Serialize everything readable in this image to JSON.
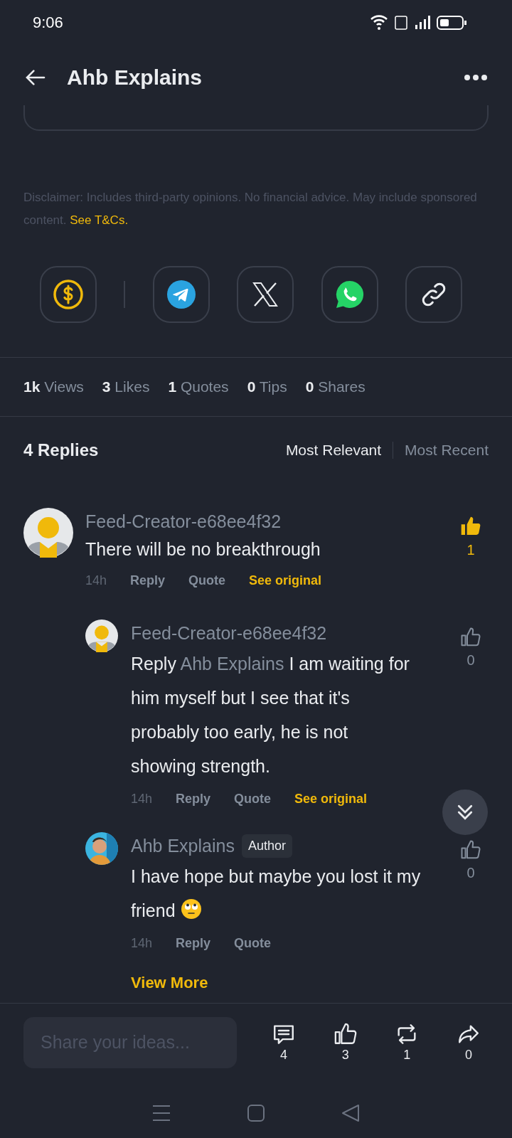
{
  "status_bar": {
    "time": "9:06"
  },
  "header": {
    "title": "Ahb Explains"
  },
  "disclaimer": {
    "text": "Disclaimer: Includes third-party opinions. No financial advice. May include sponsored content.",
    "link": "See T&Cs."
  },
  "share_buttons": [
    {
      "kind": "tip"
    },
    {
      "kind": "telegram"
    },
    {
      "kind": "x"
    },
    {
      "kind": "whatsapp"
    },
    {
      "kind": "link"
    }
  ],
  "stats": [
    {
      "text": "**1k** Views"
    },
    {
      "text": "**3** Likes"
    },
    {
      "text": "**1** Quotes"
    },
    {
      "text": "**0** Tips"
    },
    {
      "text": "**0** Shares"
    }
  ],
  "replies_header": {
    "title": "4 Replies",
    "sort_tabs": [
      {
        "label": "Most Relevant",
        "selected": true
      },
      {
        "label": "Most Recent",
        "selected": false
      }
    ]
  },
  "comments": [
    {
      "author": "Feed-Creator-e68ee4f32",
      "avatar": {
        "kind": "default"
      },
      "text": "There will be no breakthrough",
      "liked": true,
      "likes": "1",
      "time": "14h",
      "actions": [
        {
          "label": "Reply",
          "kind": "plain"
        },
        {
          "label": "Quote",
          "kind": "plain"
        },
        {
          "label": "See original",
          "kind": "accent"
        }
      ],
      "children": [
        {
          "author": "Feed-Creator-e68ee4f32",
          "avatar": {
            "kind": "default"
          },
          "reply_prefix": "Reply",
          "mention": "Ahb Explains",
          "text": "I am waiting for him myself but I see that it's probably too early, he is not showing strength.",
          "liked": false,
          "likes": "0",
          "time": "14h",
          "actions": [
            {
              "label": "Reply",
              "kind": "plain"
            },
            {
              "label": "Quote",
              "kind": "plain"
            },
            {
              "label": "See original",
              "kind": "accent"
            }
          ]
        },
        {
          "author": "Ahb Explains",
          "avatar": {
            "kind": "picture"
          },
          "badge": "Author",
          "text": "I have hope but maybe you lost it my friend",
          "emoji": true,
          "liked": false,
          "likes": "0",
          "time": "14h",
          "actions": [
            {
              "label": "Reply",
              "kind": "plain"
            },
            {
              "label": "Quote",
              "kind": "plain"
            }
          ]
        }
      ],
      "view_more": "View More"
    }
  ],
  "composer": {
    "placeholder": "Share your ideas..."
  },
  "bottom_actions": [
    {
      "kind": "comment",
      "count": "4"
    },
    {
      "kind": "like",
      "count": "3"
    },
    {
      "kind": "repost",
      "count": "1"
    },
    {
      "kind": "share",
      "count": "0"
    }
  ]
}
